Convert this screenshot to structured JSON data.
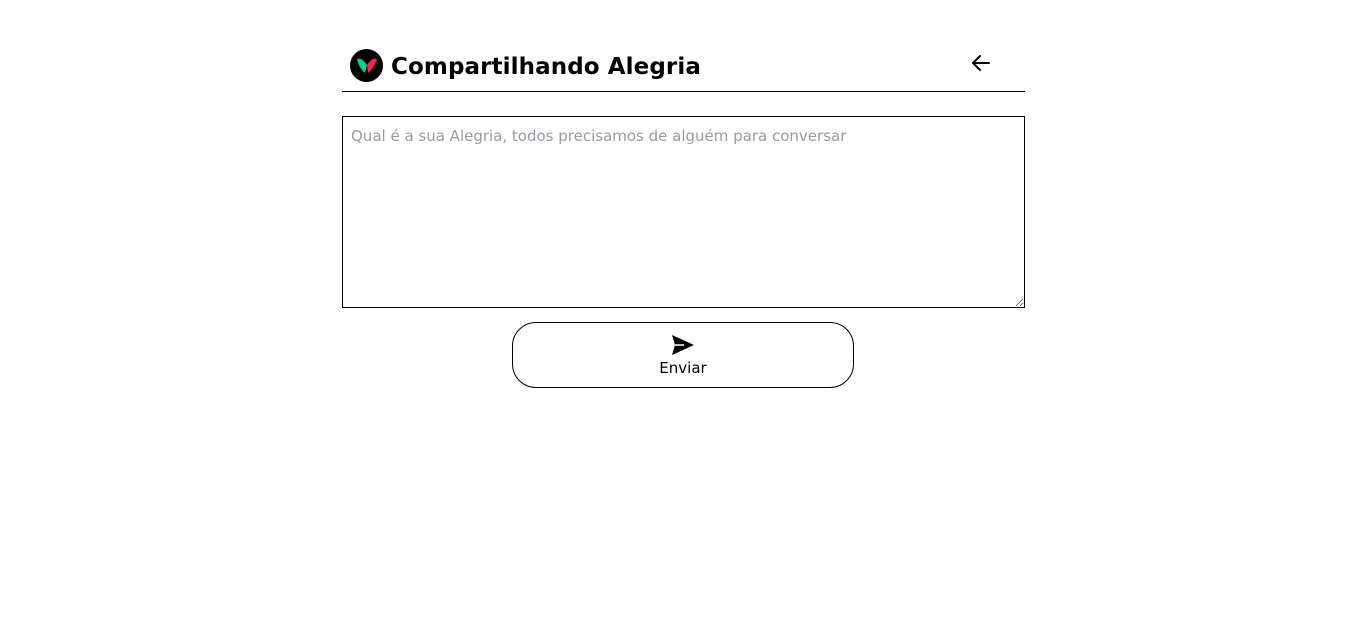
{
  "header": {
    "title": "Compartilhando Alegria",
    "logo_icon": "heart-logo-icon",
    "back_icon": "arrow-left-icon"
  },
  "message": {
    "placeholder": "Qual é a sua Alegria, todos precisamos de alguém para conversar",
    "value": ""
  },
  "send": {
    "label": "Enviar",
    "icon": "send-icon"
  },
  "colors": {
    "logo_green": "#00d18b",
    "logo_pink": "#ff1f5a",
    "border": "#000000",
    "placeholder": "#9a9aa3"
  }
}
